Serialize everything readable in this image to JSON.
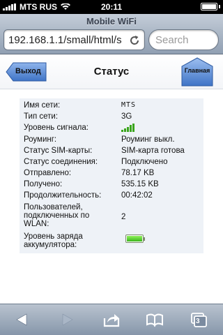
{
  "statusbar": {
    "carrier": "MTS RUS",
    "time": "20:11"
  },
  "browser": {
    "title": "Mobile WiFi",
    "url": "192.168.1.1/small/html/s",
    "search_placeholder": "Search",
    "tab_count": "3"
  },
  "page": {
    "back_label": "Выход",
    "heading": "Статус",
    "home_label": "Главная"
  },
  "status": {
    "rows": [
      {
        "label": "Имя сети:",
        "value": "MTS"
      },
      {
        "label": "Тип сети:",
        "value": "3G"
      },
      {
        "label": "Уровень сигнала:"
      },
      {
        "label": "Роуминг:",
        "value": "Роуминг выкл."
      },
      {
        "label": "Статус SIM-карты:",
        "value": "SIM-карта готова"
      },
      {
        "label": "Статус соединения:",
        "value": "Подключено"
      },
      {
        "label": "Отправлено:",
        "value": "78.17 KB"
      },
      {
        "label": "Получено:",
        "value": "535.15 KB"
      },
      {
        "label": "Продолжительность:",
        "value": "00:42:02"
      },
      {
        "label": "Пользователей, подключенных по WLAN:",
        "value": "2"
      },
      {
        "label": "Уровень заряда аккумулятора:"
      }
    ],
    "signal_level": 5,
    "signal_max": 5,
    "battery_level": 1.0
  },
  "colors": {
    "signal": "#3aa51c",
    "battery": "#5ad42a",
    "button_blue": "#4a7fd0"
  }
}
